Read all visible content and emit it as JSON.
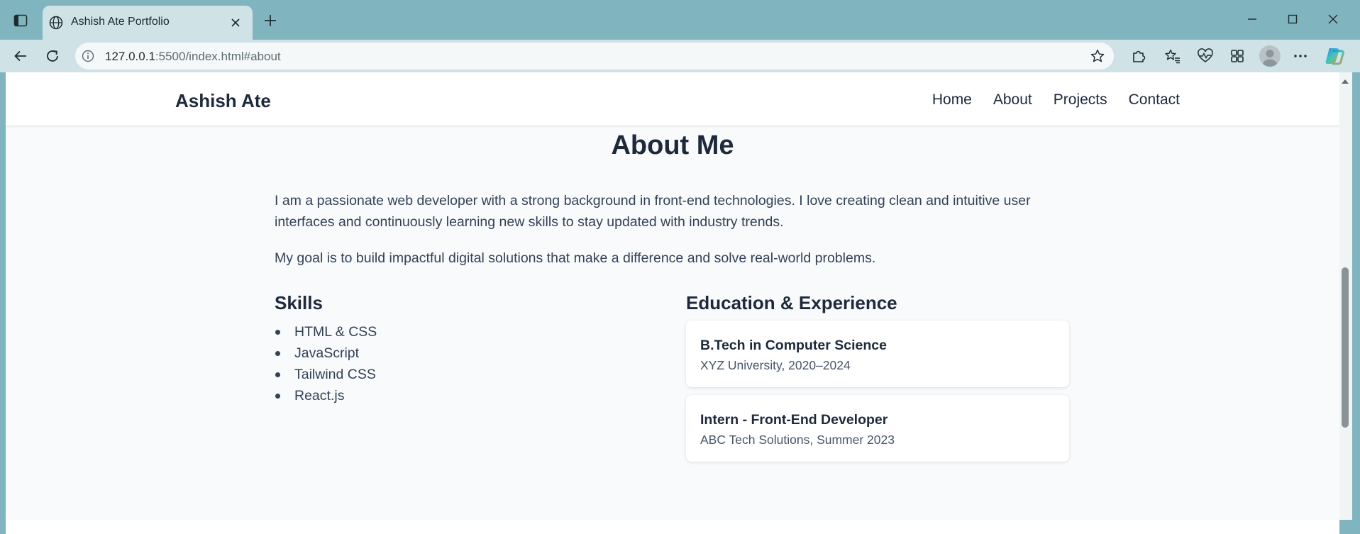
{
  "browser": {
    "tab_title": "Ashish Ate Portfolio",
    "url_host": "127.0.0.1",
    "url_path": ":5500/index.html#about"
  },
  "site": {
    "brand": "Ashish Ate",
    "nav": [
      "Home",
      "About",
      "Projects",
      "Contact"
    ]
  },
  "about": {
    "title": "About Me",
    "para1": "I am a passionate web developer with a strong background in front-end technologies. I love creating clean and intuitive user interfaces and continuously learning new skills to stay updated with industry trends.",
    "para2": "My goal is to build impactful digital solutions that make a difference and solve real-world problems.",
    "skills_title": "Skills",
    "skills": [
      "HTML & CSS",
      "JavaScript",
      "Tailwind CSS",
      "React.js"
    ],
    "edu_title": "Education & Experience",
    "cards": [
      {
        "title": "B.Tech in Computer Science",
        "sub": "XYZ University, 2020–2024"
      },
      {
        "title": "Intern - Front-End Developer",
        "sub": "ABC Tech Solutions, Summer 2023"
      }
    ]
  },
  "icons": {
    "sidebar": "sidebar-toggle-icon",
    "globe": "globe-icon",
    "close": "close-icon",
    "new_tab": "plus-icon",
    "back": "back-arrow-icon",
    "refresh": "refresh-icon",
    "info": "info-icon",
    "star": "star-icon",
    "extensions": "puzzle-icon",
    "favorites": "favorites-icon",
    "health": "heart-pulse-icon",
    "collections": "collections-icon",
    "menu": "more-icon",
    "copilot": "copilot-icon"
  },
  "colors": {
    "titlebar": "#80b5bf",
    "toolbar": "#cfe3e7",
    "page_bg": "#f8fafc",
    "text_dark": "#1e293b"
  }
}
